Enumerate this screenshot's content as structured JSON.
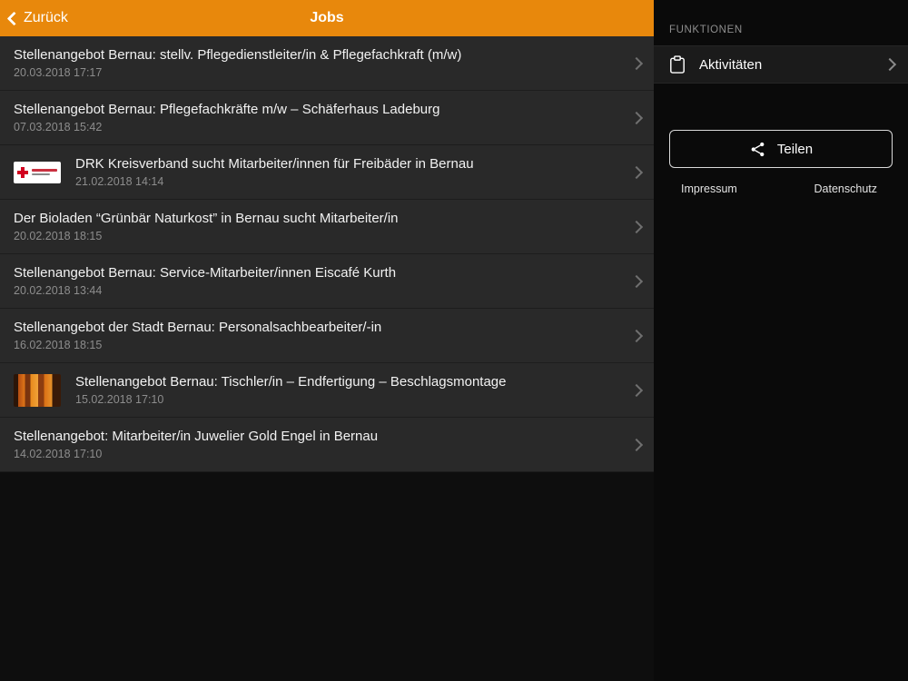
{
  "header": {
    "back_label": "Zurück",
    "title": "Jobs"
  },
  "jobs": [
    {
      "title": "Stellenangebot Bernau: stellv. Pflegedienstleiter/in & Pflegefachkraft (m/w)",
      "date": "20.03.2018 17:17",
      "thumb": null
    },
    {
      "title": "Stellenangebot Bernau: Pflegefachkräfte m/w – Schäferhaus Ladeburg",
      "date": "07.03.2018 15:42",
      "thumb": null
    },
    {
      "title": "DRK Kreisverband sucht Mitarbeiter/innen für Freibäder in Bernau",
      "date": "21.02.2018 14:14",
      "thumb": "drk-logo"
    },
    {
      "title": "Der Bioladen “Grünbär Naturkost” in Bernau sucht Mitarbeiter/in",
      "date": "20.02.2018 18:15",
      "thumb": null
    },
    {
      "title": "Stellenangebot Bernau: Service-Mitarbeiter/innen Eiscafé Kurth",
      "date": "20.02.2018 13:44",
      "thumb": null
    },
    {
      "title": "Stellenangebot der Stadt Bernau: Personalsachbearbeiter/-in",
      "date": "16.02.2018 18:15",
      "thumb": null
    },
    {
      "title": "Stellenangebot Bernau: Tischler/in – Endfertigung – Beschlagsmontage",
      "date": "15.02.2018 17:10",
      "thumb": "wood-photo"
    },
    {
      "title": "Stellenangebot: Mitarbeiter/in Juwelier Gold Engel in Bernau",
      "date": "14.02.2018 17:10",
      "thumb": null
    }
  ],
  "sidebar": {
    "section_title": "FUNKTIONEN",
    "activities_label": "Aktivitäten",
    "share_label": "Teilen",
    "impressum_label": "Impressum",
    "datenschutz_label": "Datenschutz"
  },
  "colors": {
    "accent_orange": "#e8880c",
    "list_background": "#292929",
    "panel_background": "#0a0a0a",
    "drk_red": "#d1001f"
  }
}
